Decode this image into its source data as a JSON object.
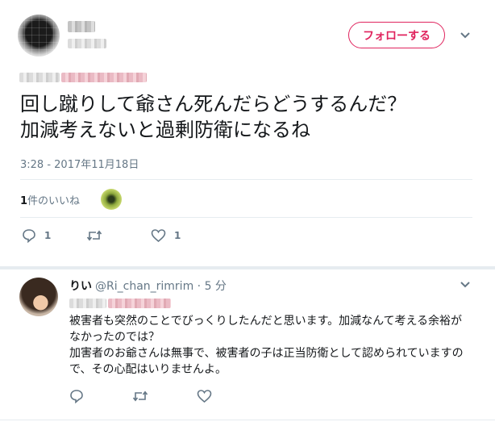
{
  "main_tweet": {
    "follow_label": "フォローする",
    "text_lines": [
      "回し蹴りして爺さん死んだらどうするんだ？",
      "加減考えないと過剰防衛になるね"
    ],
    "timestamp": "3:28 - 2017年11月18日",
    "likes_count": "1",
    "likes_suffix": "件のいいね",
    "reply_count": "1",
    "like_count": "1"
  },
  "reply": {
    "name": "りい",
    "handle": "@Ri_chan_rimrim",
    "separator": " · ",
    "time": "5 分",
    "body_lines": [
      "被害者も突然のことでびっくりしたんだと思います。加減なんて考える余裕が",
      "なかったのでは？",
      "加害者のお爺さんは無事で、被害者の子は正当防衛として認められていますの",
      "で、その心配はいりませんよ。"
    ]
  },
  "icons": [
    "chevron-down-icon",
    "reply-icon",
    "retweet-icon",
    "like-icon"
  ],
  "colors": {
    "accent": "#e0245e",
    "muted": "#657786",
    "text": "#14171a",
    "divider": "#e6ecf0"
  }
}
